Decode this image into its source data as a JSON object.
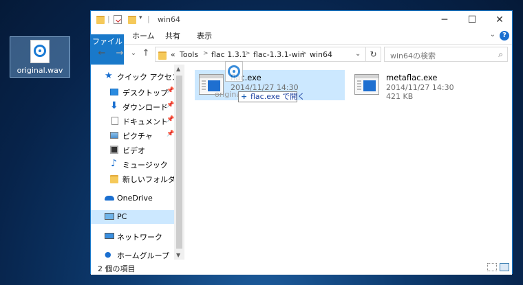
{
  "desktop": {
    "icon_label": "original.wav"
  },
  "window": {
    "title": "win64",
    "quick_access_sep": "|",
    "controls": {
      "minimize": "─",
      "maximize": "☐",
      "close": "✕"
    }
  },
  "ribbon": {
    "tabs": [
      "ファイル",
      "ホーム",
      "共有",
      "表示"
    ],
    "collapse": "⌄",
    "help": "?"
  },
  "toolbar": {
    "back": "←",
    "forward": "→",
    "recent": "⌄",
    "up": "↑"
  },
  "address": {
    "overflow": "«",
    "crumbs": [
      "Tools",
      "flac 1.3.1",
      "flac-1.3.1-win",
      "win64"
    ],
    "sep": ">",
    "dropdown": "⌄",
    "refresh": "↻"
  },
  "search": {
    "placeholder": "win64の検索",
    "icon": "⌕"
  },
  "nav": {
    "items": [
      {
        "label": "クイック アクセス",
        "icon": "star-icon"
      },
      {
        "label": "デスクトップ",
        "icon": "desktop-icon",
        "pinned": true
      },
      {
        "label": "ダウンロード",
        "icon": "download-icon",
        "pinned": true
      },
      {
        "label": "ドキュメント",
        "icon": "document-icon",
        "pinned": true
      },
      {
        "label": "ピクチャ",
        "icon": "picture-icon",
        "pinned": true
      },
      {
        "label": "ビデオ",
        "icon": "video-icon"
      },
      {
        "label": "ミュージック",
        "icon": "music-icon"
      },
      {
        "label": "新しいフォルダー",
        "icon": "folder-icon"
      },
      {
        "label": "OneDrive",
        "icon": "cloud-icon"
      },
      {
        "label": "PC",
        "icon": "pc-icon",
        "selected": true
      },
      {
        "label": "ネットワーク",
        "icon": "network-icon"
      },
      {
        "label": "ホームグループ",
        "icon": "homegroup-icon"
      }
    ],
    "pin_glyph": "📌"
  },
  "files": [
    {
      "name": "flac.exe",
      "date": "2014/11/27 14:30",
      "size": "",
      "selected": true
    },
    {
      "name": "metaflac.exe",
      "date": "2014/11/27 14:30",
      "size": "421 KB",
      "selected": false
    }
  ],
  "drag": {
    "ghost_label": "original.wav",
    "tooltip_plus": "+",
    "tooltip_text": "flac.exe で開く"
  },
  "status": {
    "count": "2 個の項目"
  },
  "colors": {
    "accent": "#1979ca",
    "selection": "#cce8ff"
  }
}
